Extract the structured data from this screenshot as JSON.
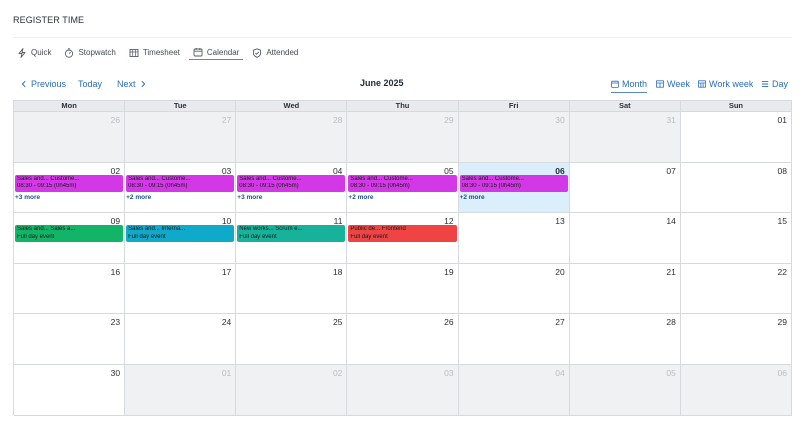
{
  "page": {
    "title": "REGISTER TIME"
  },
  "tabs": [
    {
      "label": "Quick",
      "icon": "lightning-icon",
      "active": false
    },
    {
      "label": "Stopwatch",
      "icon": "stopwatch-icon",
      "active": false
    },
    {
      "label": "Timesheet",
      "icon": "timesheet-icon",
      "active": false
    },
    {
      "label": "Calendar",
      "icon": "calendar-icon",
      "active": true
    },
    {
      "label": "Attended",
      "icon": "shield-check-icon",
      "active": false
    }
  ],
  "toolbar": {
    "previous_label": "Previous",
    "today_label": "Today",
    "next_label": "Next",
    "month_title": "June 2025",
    "views": [
      {
        "label": "Month",
        "active": true
      },
      {
        "label": "Week",
        "active": false
      },
      {
        "label": "Work week",
        "active": false
      },
      {
        "label": "Day",
        "active": false
      }
    ]
  },
  "calendar": {
    "weekdays": [
      "Mon",
      "Tue",
      "Wed",
      "Thu",
      "Fri",
      "Sat",
      "Sun"
    ],
    "weeks": [
      [
        {
          "n": "26",
          "other": true
        },
        {
          "n": "27",
          "other": true
        },
        {
          "n": "28",
          "other": true
        },
        {
          "n": "29",
          "other": true
        },
        {
          "n": "30",
          "other": true
        },
        {
          "n": "31",
          "other": true
        },
        {
          "n": "01"
        }
      ],
      [
        {
          "n": "02",
          "events": [
            {
              "l1": "Sales and... Custome...",
              "l2": "08:30 - 09:15 (0h45m)",
              "color": "#d238e6"
            }
          ],
          "more": "+3 more"
        },
        {
          "n": "03",
          "events": [
            {
              "l1": "Sales and... Custome...",
              "l2": "08:30 - 09:15 (0h45m)",
              "color": "#d238e6"
            }
          ],
          "more": "+2 more"
        },
        {
          "n": "04",
          "events": [
            {
              "l1": "Sales and... Custome...",
              "l2": "08:30 - 09:15 (0h45m)",
              "color": "#d238e6"
            }
          ],
          "more": "+3 more"
        },
        {
          "n": "05",
          "events": [
            {
              "l1": "Sales and... Custome...",
              "l2": "08:30 - 09:15 (0h45m)",
              "color": "#d238e6"
            }
          ],
          "more": "+2 more"
        },
        {
          "n": "06",
          "today": true,
          "events": [
            {
              "l1": "Sales and... Custome...",
              "l2": "08:30 - 09:15 (0h45m)",
              "color": "#d238e6"
            }
          ],
          "more": "+2 more"
        },
        {
          "n": "07"
        },
        {
          "n": "08"
        }
      ],
      [
        {
          "n": "09",
          "events": [
            {
              "l1": "Sales and... Sales a...",
              "l2": "Full day event",
              "color": "#12b568"
            }
          ]
        },
        {
          "n": "10",
          "events": [
            {
              "l1": "Sales and... Interna...",
              "l2": "Full day event",
              "color": "#0fa9c9"
            }
          ]
        },
        {
          "n": "11",
          "events": [
            {
              "l1": "New works... Scrum e...",
              "l2": "Full day event",
              "color": "#16b39a"
            }
          ]
        },
        {
          "n": "12",
          "events": [
            {
              "l1": "Public de... Frontend",
              "l2": "Full day event",
              "color": "#ee4444"
            }
          ]
        },
        {
          "n": "13"
        },
        {
          "n": "14"
        },
        {
          "n": "15"
        }
      ],
      [
        {
          "n": "16"
        },
        {
          "n": "17"
        },
        {
          "n": "18"
        },
        {
          "n": "19"
        },
        {
          "n": "20"
        },
        {
          "n": "21"
        },
        {
          "n": "22"
        }
      ],
      [
        {
          "n": "23"
        },
        {
          "n": "24"
        },
        {
          "n": "25"
        },
        {
          "n": "26"
        },
        {
          "n": "27"
        },
        {
          "n": "28"
        },
        {
          "n": "29"
        }
      ],
      [
        {
          "n": "30"
        },
        {
          "n": "01",
          "other": true
        },
        {
          "n": "02",
          "other": true
        },
        {
          "n": "03",
          "other": true
        },
        {
          "n": "04",
          "other": true
        },
        {
          "n": "05",
          "other": true
        },
        {
          "n": "06",
          "other": true
        }
      ]
    ]
  },
  "colors": {
    "accent": "#2b6cb5",
    "today_bg": "#dbeefb",
    "other_month_bg": "#f0f1f3"
  }
}
